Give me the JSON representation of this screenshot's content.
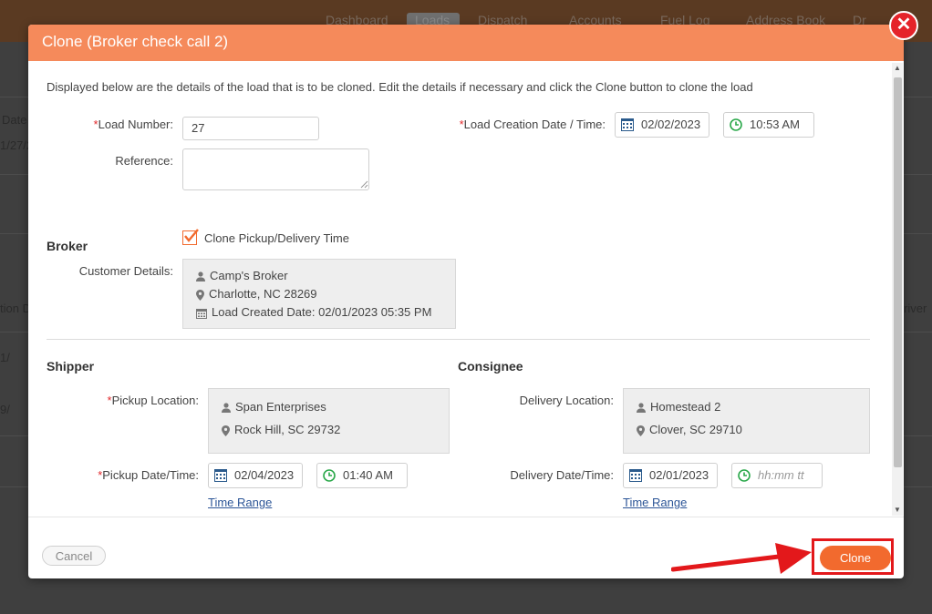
{
  "background": {
    "nav": [
      "Dashboard",
      "Loads",
      "Dispatch",
      "Accounts",
      "Fuel Log",
      "Address Book",
      "Dr"
    ],
    "left_texts": [
      "Date",
      "1/27/2",
      "tion D",
      "1/",
      "9/"
    ],
    "right_text": "river"
  },
  "modal": {
    "title": "Clone (Broker check call 2)",
    "intro": "Displayed below are the details of the load that is to be cloned. Edit the details if necessary and click the Clone button to clone the load",
    "load_number": {
      "required": "*",
      "label": "Load Number:",
      "value": "27"
    },
    "creation": {
      "required": "*",
      "label": "Load Creation Date / Time:",
      "date": "02/02/2023",
      "time": "10:53 AM"
    },
    "reference": {
      "label": "Reference:",
      "value": ""
    },
    "clone_time": {
      "label": "Clone Pickup/Delivery Time",
      "checked": true
    },
    "broker": {
      "title": "Broker",
      "label": "Customer Details:",
      "name": "Camp's Broker",
      "location": "Charlotte, NC 28269",
      "created": "Load Created Date: 02/01/2023 05:35 PM"
    },
    "shipper": {
      "title": "Shipper",
      "location_required": "*",
      "location_label": "Pickup Location:",
      "name": "Span Enterprises",
      "city": "Rock Hill, SC 29732",
      "date_required": "*",
      "date_label": "Pickup Date/Time:",
      "date": "02/04/2023",
      "time": "01:40 AM",
      "time_range": "Time Range"
    },
    "consignee": {
      "title": "Consignee",
      "location_label": "Delivery Location:",
      "name": "Homestead 2",
      "city": "Clover, SC 29710",
      "date_label": "Delivery Date/Time:",
      "date": "02/01/2023",
      "time_placeholder": "hh:mm tt",
      "time_range": "Time Range"
    },
    "footer": {
      "cancel": "Cancel",
      "clone": "Clone"
    },
    "close": "✕"
  },
  "colors": {
    "header": "#f58a5b",
    "clone_button": "#f26a2e",
    "highlight": "#e3181b",
    "close": "#e5232a",
    "link": "#2c5597"
  }
}
